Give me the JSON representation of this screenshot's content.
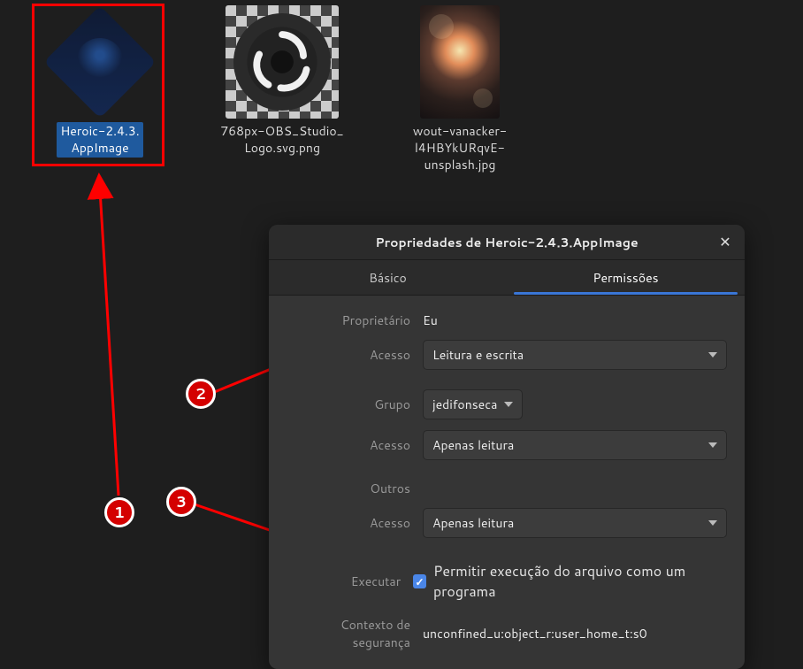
{
  "desktop": {
    "files": [
      {
        "name": "Heroic-2.4.3.\nAppImage",
        "selected": true
      },
      {
        "name": "768px-OBS_Studio_\nLogo.svg.png",
        "selected": false
      },
      {
        "name": "wout-vanacker-\nl4HBYkURqvE-\nunsplash.jpg",
        "selected": false
      }
    ]
  },
  "dialog": {
    "title": "Propriedades de Heroic-2.4.3.AppImage",
    "tabs": {
      "basic": "Básico",
      "permissions": "Permissões"
    },
    "owner_label": "Proprietário",
    "owner_value": "Eu",
    "access_label": "Acesso",
    "owner_access": "Leitura e escrita",
    "group_label": "Grupo",
    "group_value": "jedifonseca",
    "group_access": "Apenas leitura",
    "others_label": "Outros",
    "others_access": "Apenas leitura",
    "execute_label": "Executar",
    "execute_text": "Permitir execução do arquivo como um programa",
    "security_label": "Contexto de segurança",
    "security_value": "unconfined_u:object_r:user_home_t:s0"
  },
  "annotations": {
    "n1": "1",
    "n2": "2",
    "n3": "3"
  }
}
